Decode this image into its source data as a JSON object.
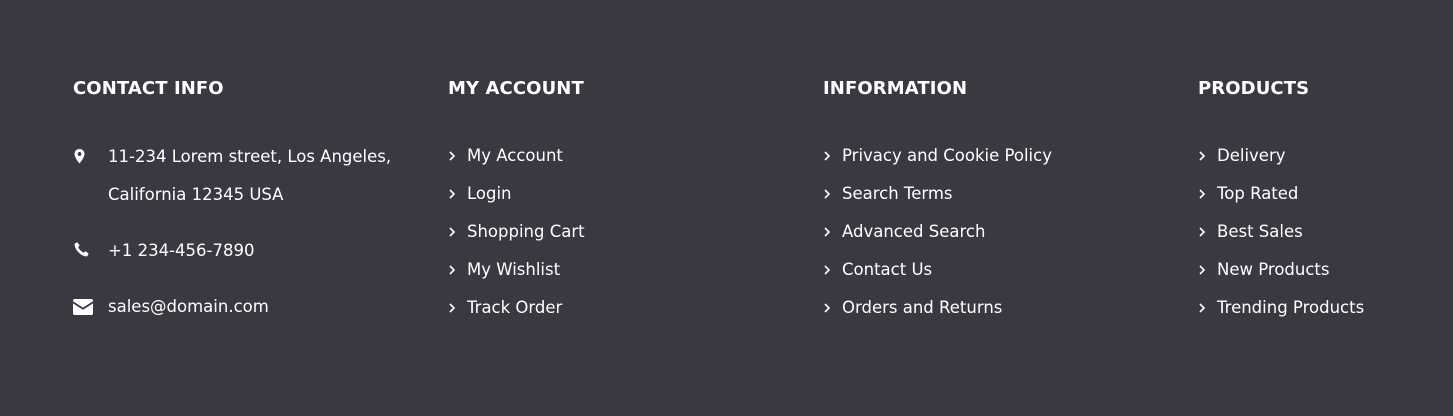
{
  "contact": {
    "title": "CONTACT INFO",
    "address_line1": "11-234 Lorem street, Los Angeles,",
    "address_line2": "California 12345 USA",
    "phone": "+1 234-456-7890",
    "email": "sales@domain.com",
    "icons": [
      "map-pin-icon",
      "phone-icon",
      "envelope-icon"
    ]
  },
  "account": {
    "title": "MY ACCOUNT",
    "items": [
      {
        "label": "My Account"
      },
      {
        "label": "Login"
      },
      {
        "label": "Shopping Cart"
      },
      {
        "label": "My Wishlist"
      },
      {
        "label": "Track Order"
      }
    ]
  },
  "information": {
    "title": "INFORMATION",
    "items": [
      {
        "label": "Privacy and Cookie Policy"
      },
      {
        "label": "Search Terms"
      },
      {
        "label": "Advanced Search"
      },
      {
        "label": "Contact Us"
      },
      {
        "label": "Orders and Returns"
      }
    ]
  },
  "products": {
    "title": "PRODUCTS",
    "items": [
      {
        "label": "Delivery"
      },
      {
        "label": "Top Rated"
      },
      {
        "label": "Best Sales"
      },
      {
        "label": "New Products"
      },
      {
        "label": "Trending Products"
      }
    ]
  },
  "colors": {
    "background": "#3a3941",
    "text": "#ffffff"
  }
}
